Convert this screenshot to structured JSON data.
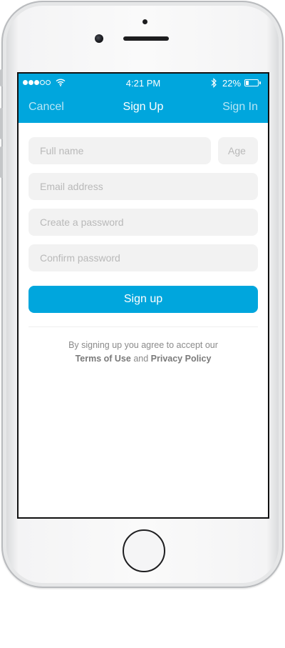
{
  "status_bar": {
    "signal_strength": 3,
    "signal_max": 5,
    "time": "4:21 PM",
    "battery_percent": "22%",
    "battery_level": 0.22,
    "icons": [
      "signal-dots-icon",
      "wifi-icon",
      "bluetooth-icon",
      "battery-icon"
    ]
  },
  "nav": {
    "left_label": "Cancel",
    "title": "Sign Up",
    "right_label": "Sign In"
  },
  "form": {
    "full_name_placeholder": "Full name",
    "age_placeholder": "Age",
    "email_placeholder": "Email address",
    "password_placeholder": "Create a password",
    "confirm_placeholder": "Confirm password",
    "submit_label": "Sign up"
  },
  "legal": {
    "line1": "By signing up you agree to accept our",
    "terms_link": "Terms of Use",
    "and": "and",
    "privacy_link": "Privacy Policy"
  },
  "colors": {
    "accent": "#00a6dd",
    "field_bg": "#f2f2f2",
    "placeholder": "#b9b9b9"
  }
}
